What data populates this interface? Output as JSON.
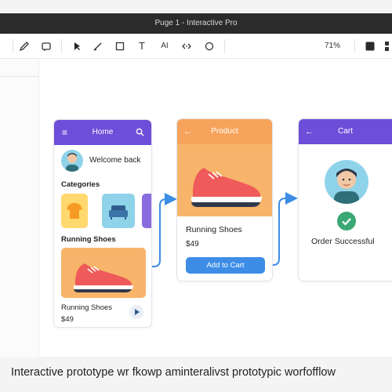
{
  "window": {
    "title": "Puge 1 - Interactive Pro"
  },
  "toolbar": {
    "zoom": "71%",
    "tools": [
      "pencil-icon",
      "frame-icon",
      "pointer-icon",
      "pen-icon",
      "rectangle-icon",
      "text-icon",
      "ai-text-icon",
      "code-icon",
      "ellipse-icon"
    ],
    "text_tool": "T",
    "ai_tool": "AI"
  },
  "screens": {
    "home": {
      "header": "Home",
      "welcome": "Welcome back",
      "categories_label": "Categories",
      "section_label": "Running Shoes",
      "product_name": "Running Shoes",
      "price": "$49"
    },
    "product": {
      "header": "Product",
      "product_name": "Running Shoes",
      "price": "$49",
      "cta": "Add to Cart"
    },
    "cart": {
      "header": "Cart",
      "message": "Order Successful"
    }
  },
  "colors": {
    "purple": "#6d4ed8",
    "orange": "#f7a35c",
    "blue_button": "#3d8de6",
    "success_green": "#3aa874",
    "connector": "#3d8de6"
  },
  "caption": "Interactive prototype wr fkowp aminteralivst prototypic worfofflow"
}
